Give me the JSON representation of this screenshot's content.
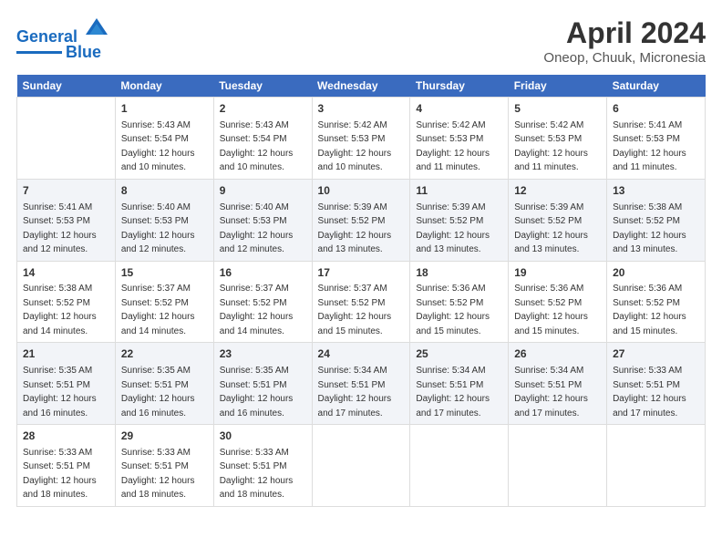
{
  "header": {
    "logo_line1": "General",
    "logo_line2": "Blue",
    "main_title": "April 2024",
    "subtitle": "Oneop, Chuuk, Micronesia"
  },
  "columns": [
    "Sunday",
    "Monday",
    "Tuesday",
    "Wednesday",
    "Thursday",
    "Friday",
    "Saturday"
  ],
  "weeks": [
    [
      {
        "day": "",
        "content": ""
      },
      {
        "day": "1",
        "content": "Sunrise: 5:43 AM\nSunset: 5:54 PM\nDaylight: 12 hours\nand 10 minutes."
      },
      {
        "day": "2",
        "content": "Sunrise: 5:43 AM\nSunset: 5:54 PM\nDaylight: 12 hours\nand 10 minutes."
      },
      {
        "day": "3",
        "content": "Sunrise: 5:42 AM\nSunset: 5:53 PM\nDaylight: 12 hours\nand 10 minutes."
      },
      {
        "day": "4",
        "content": "Sunrise: 5:42 AM\nSunset: 5:53 PM\nDaylight: 12 hours\nand 11 minutes."
      },
      {
        "day": "5",
        "content": "Sunrise: 5:42 AM\nSunset: 5:53 PM\nDaylight: 12 hours\nand 11 minutes."
      },
      {
        "day": "6",
        "content": "Sunrise: 5:41 AM\nSunset: 5:53 PM\nDaylight: 12 hours\nand 11 minutes."
      }
    ],
    [
      {
        "day": "7",
        "content": "Sunrise: 5:41 AM\nSunset: 5:53 PM\nDaylight: 12 hours\nand 12 minutes."
      },
      {
        "day": "8",
        "content": "Sunrise: 5:40 AM\nSunset: 5:53 PM\nDaylight: 12 hours\nand 12 minutes."
      },
      {
        "day": "9",
        "content": "Sunrise: 5:40 AM\nSunset: 5:53 PM\nDaylight: 12 hours\nand 12 minutes."
      },
      {
        "day": "10",
        "content": "Sunrise: 5:39 AM\nSunset: 5:52 PM\nDaylight: 12 hours\nand 13 minutes."
      },
      {
        "day": "11",
        "content": "Sunrise: 5:39 AM\nSunset: 5:52 PM\nDaylight: 12 hours\nand 13 minutes."
      },
      {
        "day": "12",
        "content": "Sunrise: 5:39 AM\nSunset: 5:52 PM\nDaylight: 12 hours\nand 13 minutes."
      },
      {
        "day": "13",
        "content": "Sunrise: 5:38 AM\nSunset: 5:52 PM\nDaylight: 12 hours\nand 13 minutes."
      }
    ],
    [
      {
        "day": "14",
        "content": "Sunrise: 5:38 AM\nSunset: 5:52 PM\nDaylight: 12 hours\nand 14 minutes."
      },
      {
        "day": "15",
        "content": "Sunrise: 5:37 AM\nSunset: 5:52 PM\nDaylight: 12 hours\nand 14 minutes."
      },
      {
        "day": "16",
        "content": "Sunrise: 5:37 AM\nSunset: 5:52 PM\nDaylight: 12 hours\nand 14 minutes."
      },
      {
        "day": "17",
        "content": "Sunrise: 5:37 AM\nSunset: 5:52 PM\nDaylight: 12 hours\nand 15 minutes."
      },
      {
        "day": "18",
        "content": "Sunrise: 5:36 AM\nSunset: 5:52 PM\nDaylight: 12 hours\nand 15 minutes."
      },
      {
        "day": "19",
        "content": "Sunrise: 5:36 AM\nSunset: 5:52 PM\nDaylight: 12 hours\nand 15 minutes."
      },
      {
        "day": "20",
        "content": "Sunrise: 5:36 AM\nSunset: 5:52 PM\nDaylight: 12 hours\nand 15 minutes."
      }
    ],
    [
      {
        "day": "21",
        "content": "Sunrise: 5:35 AM\nSunset: 5:51 PM\nDaylight: 12 hours\nand 16 minutes."
      },
      {
        "day": "22",
        "content": "Sunrise: 5:35 AM\nSunset: 5:51 PM\nDaylight: 12 hours\nand 16 minutes."
      },
      {
        "day": "23",
        "content": "Sunrise: 5:35 AM\nSunset: 5:51 PM\nDaylight: 12 hours\nand 16 minutes."
      },
      {
        "day": "24",
        "content": "Sunrise: 5:34 AM\nSunset: 5:51 PM\nDaylight: 12 hours\nand 17 minutes."
      },
      {
        "day": "25",
        "content": "Sunrise: 5:34 AM\nSunset: 5:51 PM\nDaylight: 12 hours\nand 17 minutes."
      },
      {
        "day": "26",
        "content": "Sunrise: 5:34 AM\nSunset: 5:51 PM\nDaylight: 12 hours\nand 17 minutes."
      },
      {
        "day": "27",
        "content": "Sunrise: 5:33 AM\nSunset: 5:51 PM\nDaylight: 12 hours\nand 17 minutes."
      }
    ],
    [
      {
        "day": "28",
        "content": "Sunrise: 5:33 AM\nSunset: 5:51 PM\nDaylight: 12 hours\nand 18 minutes."
      },
      {
        "day": "29",
        "content": "Sunrise: 5:33 AM\nSunset: 5:51 PM\nDaylight: 12 hours\nand 18 minutes."
      },
      {
        "day": "30",
        "content": "Sunrise: 5:33 AM\nSunset: 5:51 PM\nDaylight: 12 hours\nand 18 minutes."
      },
      {
        "day": "",
        "content": ""
      },
      {
        "day": "",
        "content": ""
      },
      {
        "day": "",
        "content": ""
      },
      {
        "day": "",
        "content": ""
      }
    ]
  ]
}
